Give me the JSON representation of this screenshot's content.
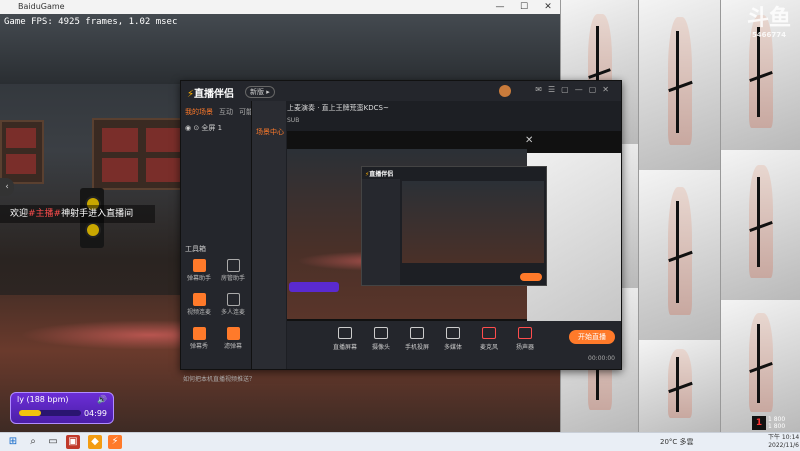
{
  "game_window": {
    "title": "BaiduGame",
    "fps_text": "Game FPS: 4925 frames, 1.02 msec",
    "controls": [
      "—",
      "☐",
      "✕"
    ],
    "welcome": {
      "prefix": "欢迎",
      "name": "#主播#",
      "suffix": "神射手进入直播间"
    }
  },
  "music_widget": {
    "title": "ly (188 bpm)",
    "time": "04:99",
    "progress": 0.35,
    "volume_icon": "volume-icon"
  },
  "watermark": {
    "logo": "斗鱼",
    "id": "5466774"
  },
  "app": {
    "name": "直播伴侣",
    "badge": "新版 ▸",
    "tabs": [
      "我的场景",
      "互动",
      "可能用"
    ],
    "scene_label": "◉ ⊙ 全屏 1",
    "stream_title": "上麦演奏 · 直上王牌荒蛮KDCS~",
    "stream_sub": "SUB",
    "toolbox_title": "工具箱",
    "help_icon": "...",
    "mid_head": "场景中心",
    "tools": [
      {
        "label": "弹幕助手",
        "accent": true
      },
      {
        "label": "房管助手",
        "accent": false
      },
      {
        "label": "主播任务",
        "accent": false
      },
      {
        "label": "视频连麦",
        "accent": true
      },
      {
        "label": "多人连麦",
        "accent": false
      },
      {
        "label": "精华视频",
        "accent": false
      },
      {
        "label": "弹幕秀",
        "accent": true
      },
      {
        "label": "滤弹幕",
        "accent": true
      },
      {
        "label": "虚拟形象",
        "accent": false
      }
    ],
    "bottom_note": "如何把本机直播视频推送？",
    "bottom_actions": [
      {
        "label": "直播屏幕",
        "red": false
      },
      {
        "label": "摄像头",
        "red": false
      },
      {
        "label": "手机投屏",
        "red": false
      },
      {
        "label": "多媒体",
        "red": false
      },
      {
        "label": "麦克风",
        "red": true
      },
      {
        "label": "扬声器",
        "red": true
      }
    ],
    "live_button": "开始直播",
    "live_time": "00:00:00",
    "inner_app_name": "直播伴侣"
  },
  "taskbar": {
    "weather": "20°C 多雲",
    "time": "下午 10:14",
    "date": "2022/11/6",
    "tray_badge": "1",
    "tray_stats": [
      "1 800",
      "1 800"
    ]
  },
  "colors": {
    "accent": "#ff7a2a",
    "music_bg": "#6b2ed6",
    "taskbar": "#e9eef5"
  }
}
